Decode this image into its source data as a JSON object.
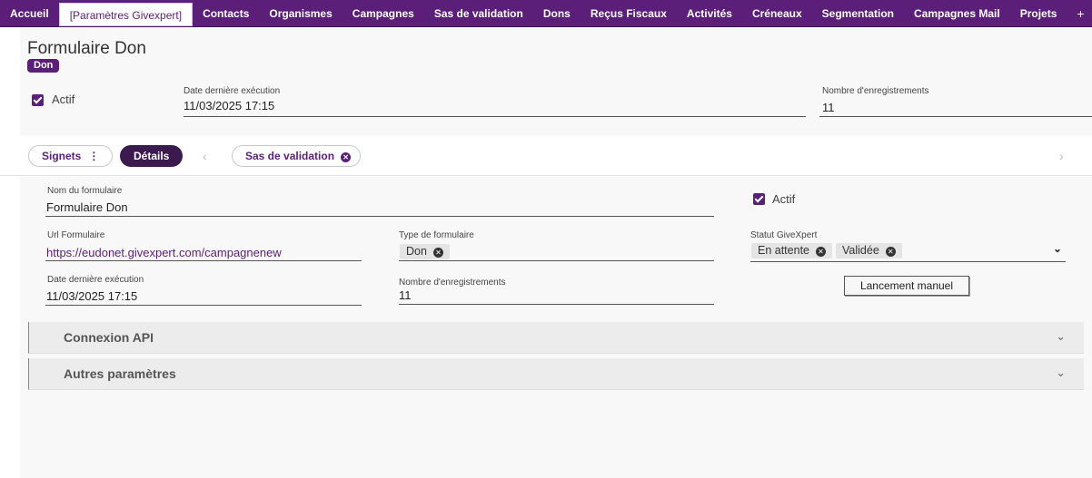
{
  "nav": {
    "tabs": [
      "Accueil",
      "[Paramètres Givexpert]",
      "Contacts",
      "Organismes",
      "Campagnes",
      "Sas de validation",
      "Dons",
      "Reçus Fiscaux",
      "Activités",
      "Créneaux",
      "Segmentation",
      "Campagnes Mail",
      "Projets",
      "+"
    ],
    "active_index": 1
  },
  "header": {
    "title": "Formulaire Don",
    "badge": "Don",
    "actif_label": "Actif",
    "date_label": "Date dernière exécution",
    "date_value": "11/03/2025 17:15",
    "count_label": "Nombre d'enregistrements",
    "count_value": "11"
  },
  "toolbar": {
    "signets": "Signets",
    "signets_icon": "more-vertical-icon",
    "details": "Détails",
    "sas": "Sas de validation"
  },
  "form": {
    "nom_label": "Nom du formulaire",
    "nom_value": "Formulaire Don",
    "actif_label": "Actif",
    "url_label": "Url Formulaire",
    "url_value": "https://eudonet.givexpert.com/campagnenew",
    "type_label": "Type de formulaire",
    "type_chip": "Don",
    "statut_label": "Statut GiveXpert",
    "statut_chips": [
      "En attente",
      "Validée"
    ],
    "date_label": "Date dernière exécution",
    "date_value": "11/03/2025 17:15",
    "count_label": "Nombre d'enregistrements",
    "count_value": "11",
    "button": "Lancement manuel"
  },
  "sections": [
    "Connexion API",
    "Autres paramètres"
  ],
  "colors": {
    "accent": "#5b1f7a",
    "dark_pill": "#3b1a4f"
  }
}
